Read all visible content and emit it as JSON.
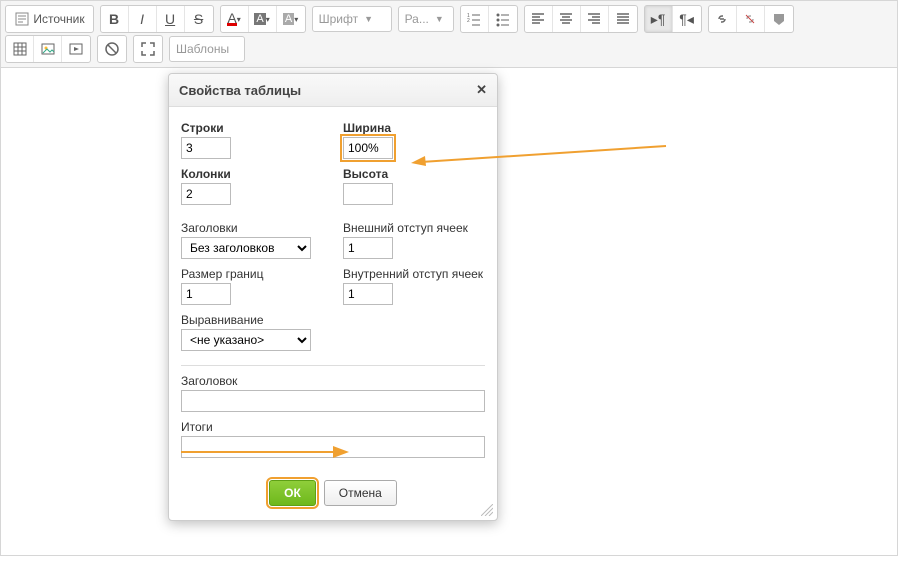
{
  "toolbar": {
    "source_label": "Источник",
    "font_label": "Шрифт",
    "size_label": "Ра...",
    "templates_label": "Шаблоны"
  },
  "dialog": {
    "title": "Свойства таблицы",
    "rows_label": "Строки",
    "rows_value": "3",
    "cols_label": "Колонки",
    "cols_value": "2",
    "headers_label": "Заголовки",
    "headers_value": "Без заголовков",
    "border_label": "Размер границ",
    "border_value": "1",
    "align_label": "Выравнивание",
    "align_value": "<не указано>",
    "width_label": "Ширина",
    "width_value": "100%",
    "height_label": "Высота",
    "height_value": "",
    "cellspacing_label": "Внешний отступ ячеек",
    "cellspacing_value": "1",
    "cellpadding_label": "Внутренний отступ ячеек",
    "cellpadding_value": "1",
    "caption_label": "Заголовок",
    "caption_value": "",
    "summary_label": "Итоги",
    "summary_value": "",
    "ok_label": "ОК",
    "cancel_label": "Отмена"
  }
}
